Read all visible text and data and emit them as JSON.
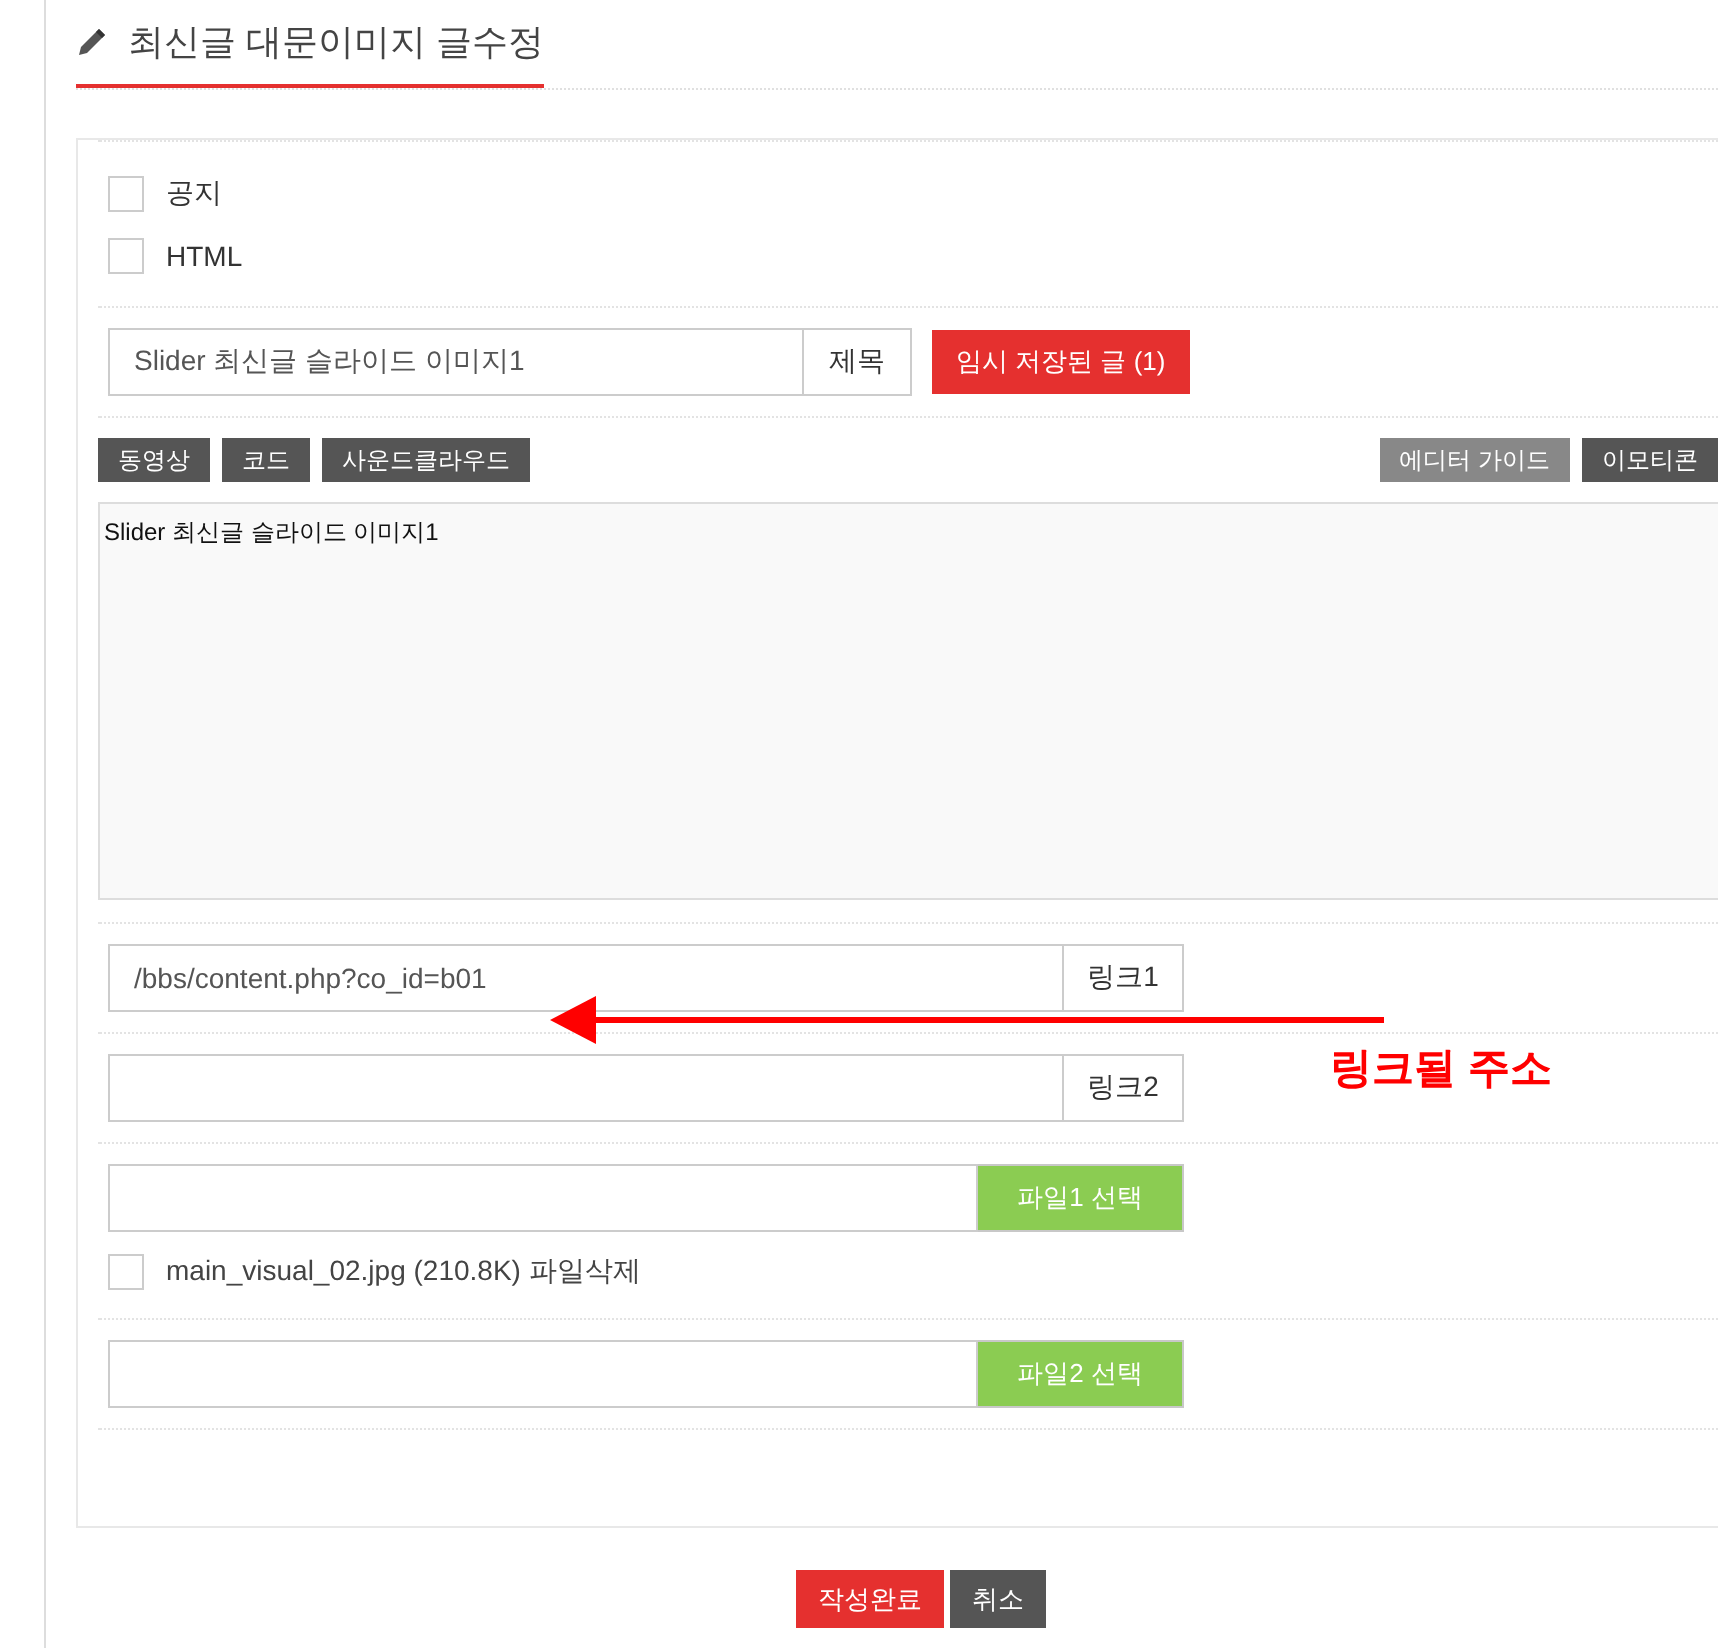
{
  "header": {
    "title": "최신글 대문이미지 글수정"
  },
  "options": [
    {
      "label": "공지",
      "checked": false
    },
    {
      "label": "HTML",
      "checked": false
    }
  ],
  "subject": {
    "value": "Slider 최신글 슬라이드 이미지1",
    "label": "제목"
  },
  "draft_button": "임시 저장된 글 (1)",
  "editor": {
    "left_buttons": [
      "동영상",
      "코드",
      "사운드클라우드"
    ],
    "right_buttons": [
      {
        "label": "에디터 가이드",
        "kind": "light"
      },
      {
        "label": "이모티콘",
        "kind": "dark"
      }
    ],
    "content": "Slider 최신글 슬라이드 이미지1"
  },
  "links": [
    {
      "value": "/bbs/content.php?co_id=b01",
      "label": "링크1"
    },
    {
      "label": "링크2"
    }
  ],
  "files": [
    {
      "button": "파일1 선택",
      "existing": {
        "label": "main_visual_02.jpg (210.8K) 파일삭제",
        "checked": false
      }
    },
    {
      "button": "파일2 선택"
    }
  ],
  "actions": [
    {
      "label": "작성완료",
      "kind": "primary"
    },
    {
      "label": "취소",
      "kind": "secondary"
    }
  ],
  "annotation": {
    "text": "링크될 주소"
  }
}
